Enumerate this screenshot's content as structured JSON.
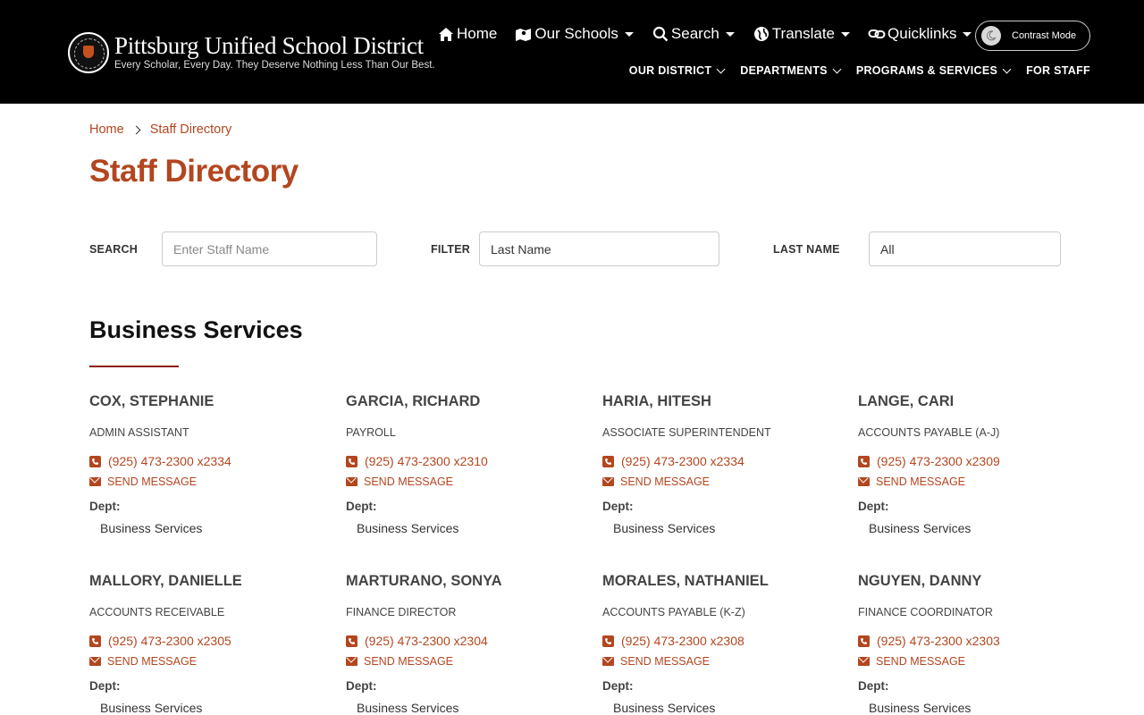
{
  "header": {
    "logo_title": "Pittsburg Unified School District",
    "logo_tagline": "Every Scholar, Every Day. They Deserve Nothing Less Than Our Best.",
    "top_nav": [
      {
        "label": "Home",
        "icon": "home-icon",
        "dropdown": false
      },
      {
        "label": "Our Schools",
        "icon": "map-icon",
        "dropdown": true
      },
      {
        "label": "Search",
        "icon": "search-icon",
        "dropdown": true
      },
      {
        "label": "Translate",
        "icon": "globe-icon",
        "dropdown": true
      },
      {
        "label": "Quicklinks",
        "icon": "link-icon",
        "dropdown": true
      }
    ],
    "contrast_label": "Contrast Mode",
    "sub_nav": [
      {
        "label": "OUR DISTRICT",
        "dropdown": true
      },
      {
        "label": "DEPARTMENTS",
        "dropdown": true
      },
      {
        "label": "PROGRAMS & SERVICES",
        "dropdown": true
      },
      {
        "label": "FOR STAFF",
        "dropdown": false
      }
    ]
  },
  "breadcrumb": {
    "home": "Home",
    "current": "Staff Directory"
  },
  "page_title": "Staff Directory",
  "filters": {
    "search_label": "SEARCH",
    "search_placeholder": "Enter Staff Name",
    "filter_label": "FILTER",
    "filter_value": "Last Name",
    "lastname_label": "LAST NAME",
    "lastname_value": "All"
  },
  "section": {
    "title": "Business Services",
    "staff": [
      {
        "name": "COX, STEPHANIE",
        "title": "ADMIN ASSISTANT",
        "phone": "(925) 473-2300 x2334",
        "message": "SEND MESSAGE",
        "dept_label": "Dept:",
        "dept": "Business Services"
      },
      {
        "name": "GARCIA, RICHARD",
        "title": "PAYROLL",
        "phone": "(925) 473-2300 x2310",
        "message": "SEND MESSAGE",
        "dept_label": "Dept:",
        "dept": "Business Services"
      },
      {
        "name": "HARIA, HITESH",
        "title": "ASSOCIATE SUPERINTENDENT",
        "phone": "(925) 473-2300 x2334",
        "message": "SEND MESSAGE",
        "dept_label": "Dept:",
        "dept": "Business Services"
      },
      {
        "name": "LANGE, CARI",
        "title": "ACCOUNTS PAYABLE (A-J)",
        "phone": "(925) 473-2300 x2309",
        "message": "SEND MESSAGE",
        "dept_label": "Dept:",
        "dept": "Business Services"
      },
      {
        "name": "MALLORY, DANIELLE",
        "title": "ACCOUNTS RECEIVABLE",
        "phone": "(925) 473-2300 x2305",
        "message": "SEND MESSAGE",
        "dept_label": "Dept:",
        "dept": "Business Services"
      },
      {
        "name": "MARTURANO, SONYA",
        "title": "FINANCE DIRECTOR",
        "phone": "(925) 473-2300 x2304",
        "message": "SEND MESSAGE",
        "dept_label": "Dept:",
        "dept": "Business Services"
      },
      {
        "name": "MORALES, NATHANIEL",
        "title": "ACCOUNTS PAYABLE (K-Z)",
        "phone": "(925) 473-2300 x2308",
        "message": "SEND MESSAGE",
        "dept_label": "Dept:",
        "dept": "Business Services"
      },
      {
        "name": "NGUYEN, DANNY",
        "title": "FINANCE COORDINATOR",
        "phone": "(925) 473-2300 x2303",
        "message": "SEND MESSAGE",
        "dept_label": "Dept:",
        "dept": "Business Services"
      }
    ]
  },
  "colors": {
    "accent": "#b3461f",
    "header_bg": "#000000",
    "rule": "#8b1a1a"
  }
}
